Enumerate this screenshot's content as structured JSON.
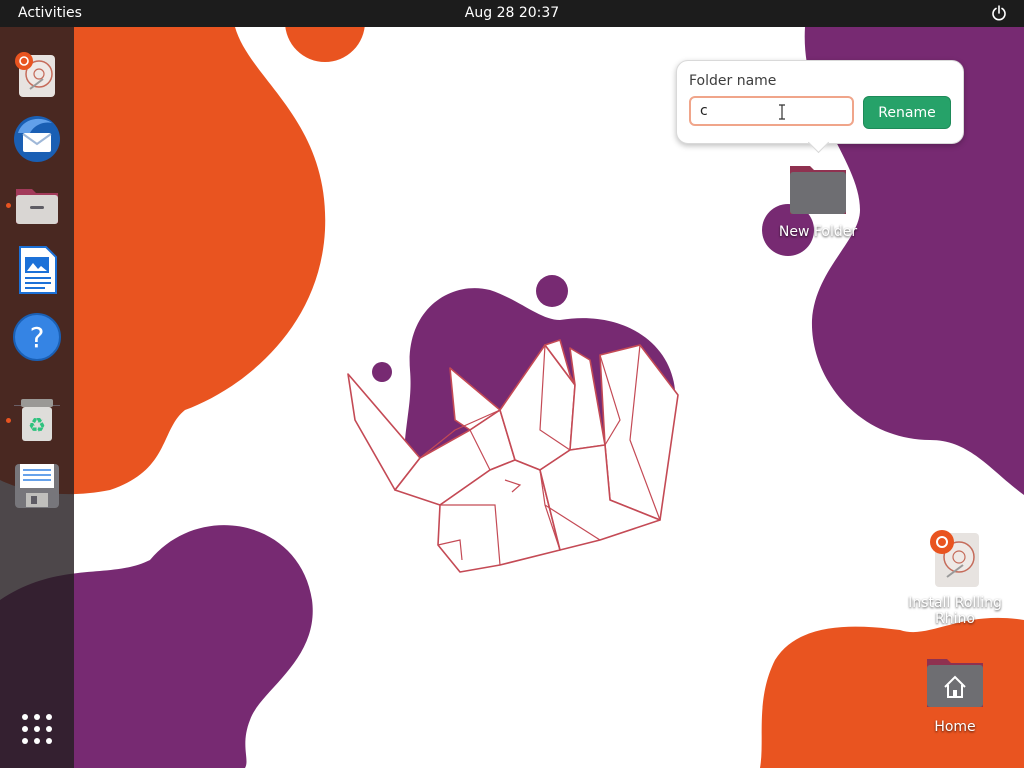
{
  "topbar": {
    "activities_label": "Activities",
    "clock": "Aug 28  20:37",
    "power_icon": "power-icon"
  },
  "dock": {
    "items": [
      {
        "name": "Install Rolling Rhino",
        "icon": "installer-icon",
        "running": false
      },
      {
        "name": "Thunderbird Mail",
        "icon": "mail-icon",
        "running": false
      },
      {
        "name": "Files",
        "icon": "files-icon",
        "running": true
      },
      {
        "name": "LibreOffice Writer",
        "icon": "writer-icon",
        "running": false
      },
      {
        "name": "Help",
        "icon": "help-icon",
        "running": false
      },
      {
        "name": "Trash",
        "icon": "trash-icon",
        "running": true
      },
      {
        "name": "Disk",
        "icon": "floppy-disk-icon",
        "running": false
      }
    ],
    "show_apps_icon": "apps-grid-icon"
  },
  "desktop": {
    "new_folder_label": "New Folder",
    "installer_label": "Install Rolling Rhino",
    "home_label": "Home"
  },
  "rename_popover": {
    "title": "Folder name",
    "input_value": "c",
    "button_label": "Rename"
  },
  "colors": {
    "orange": "#e95420",
    "purple": "#772a72",
    "rename_green": "#26a269",
    "topbar": "#1c1c1c"
  }
}
